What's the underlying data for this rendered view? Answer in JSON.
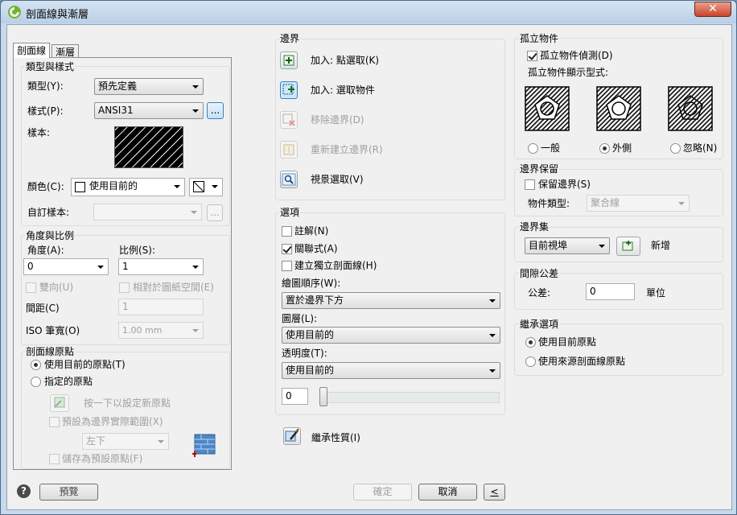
{
  "window": {
    "title": "剖面線與漸層",
    "close_glyph": "✕"
  },
  "tabs": [
    {
      "label": "剖面線"
    },
    {
      "label": "漸層"
    }
  ],
  "type_pattern": {
    "legend": "類型與樣式",
    "type_label": "類型(Y):",
    "type_value": "預先定義",
    "pattern_label": "樣式(P):",
    "pattern_value": "ANSI31",
    "browse_label": "...",
    "swatch_label": "樣本:",
    "color_label": "顏色(C):",
    "color_value": "使用目前的",
    "custom_label": "自訂樣本:",
    "custom_value": "",
    "custom_browse": "..."
  },
  "angle_scale": {
    "legend": "角度與比例",
    "angle_label": "角度(A):",
    "angle_value": "0",
    "scale_label": "比例(S):",
    "scale_value": "1",
    "double_label": "雙向(U)",
    "relative_label": "相對於圖紙空間(E)",
    "spacing_label": "間距(C)",
    "spacing_value": "1",
    "iso_label": "ISO 筆寬(O)",
    "iso_value": "1.00 mm"
  },
  "origin": {
    "legend": "剖面線原點",
    "use_current": "使用目前的原點(T)",
    "specified": "指定的原點",
    "click_set": "按一下以設定新原點",
    "default_extents": "預設為邊界實際範圍(X)",
    "position_value": "左下",
    "store_default": "儲存為預設原點(F)"
  },
  "boundaries": {
    "legend": "邊界",
    "items": [
      {
        "label": "加入: 點選取(K)",
        "enabled": true
      },
      {
        "label": "加入: 選取物件",
        "enabled": true
      },
      {
        "label": "移除邊界(D)",
        "enabled": false
      },
      {
        "label": "重新建立邊界(R)",
        "enabled": false
      },
      {
        "label": "視景選取(V)",
        "enabled": true
      }
    ]
  },
  "options": {
    "legend": "選項",
    "annotative": "註解(N)",
    "associative": "關聯式(A)",
    "separate": "建立獨立剖面線(H)",
    "draw_order_label": "繪圖順序(W):",
    "draw_order_value": "置於邊界下方",
    "layer_label": "圖層(L):",
    "layer_value": "使用目前的",
    "transparency_label": "透明度(T):",
    "transparency_value": "使用目前的",
    "transparency_number": "0",
    "transparency_level": 0
  },
  "inherit_button": "繼承性質(I)",
  "islands": {
    "legend": "孤立物件",
    "detection": "孤立物件偵測(D)",
    "style_label": "孤立物件顯示型式:",
    "styles": [
      {
        "label": "一般"
      },
      {
        "label": "外側"
      },
      {
        "label": "忽略(N)"
      }
    ],
    "selected_style": "外側"
  },
  "retain": {
    "legend": "邊界保留",
    "retain_label": "保留邊界(S)",
    "object_type_label": "物件類型:",
    "object_type_value": "聚合線"
  },
  "boundary_set": {
    "legend": "邊界集",
    "value": "目前視埠",
    "new_label": "新增"
  },
  "gap": {
    "legend": "間隙公差",
    "tolerance_label": "公差:",
    "tolerance_value": "0",
    "units_label": "單位"
  },
  "inherit_options": {
    "legend": "繼承選項",
    "use_current": "使用目前原點",
    "use_source": "使用來源剖面線原點"
  },
  "footer": {
    "help_glyph": "?",
    "preview": "預覽",
    "ok": "確定",
    "cancel": "取消",
    "collapse": "<"
  },
  "colors": {
    "accent": "#3c7fc1",
    "selected_icon_bg": "#cde8f7"
  }
}
